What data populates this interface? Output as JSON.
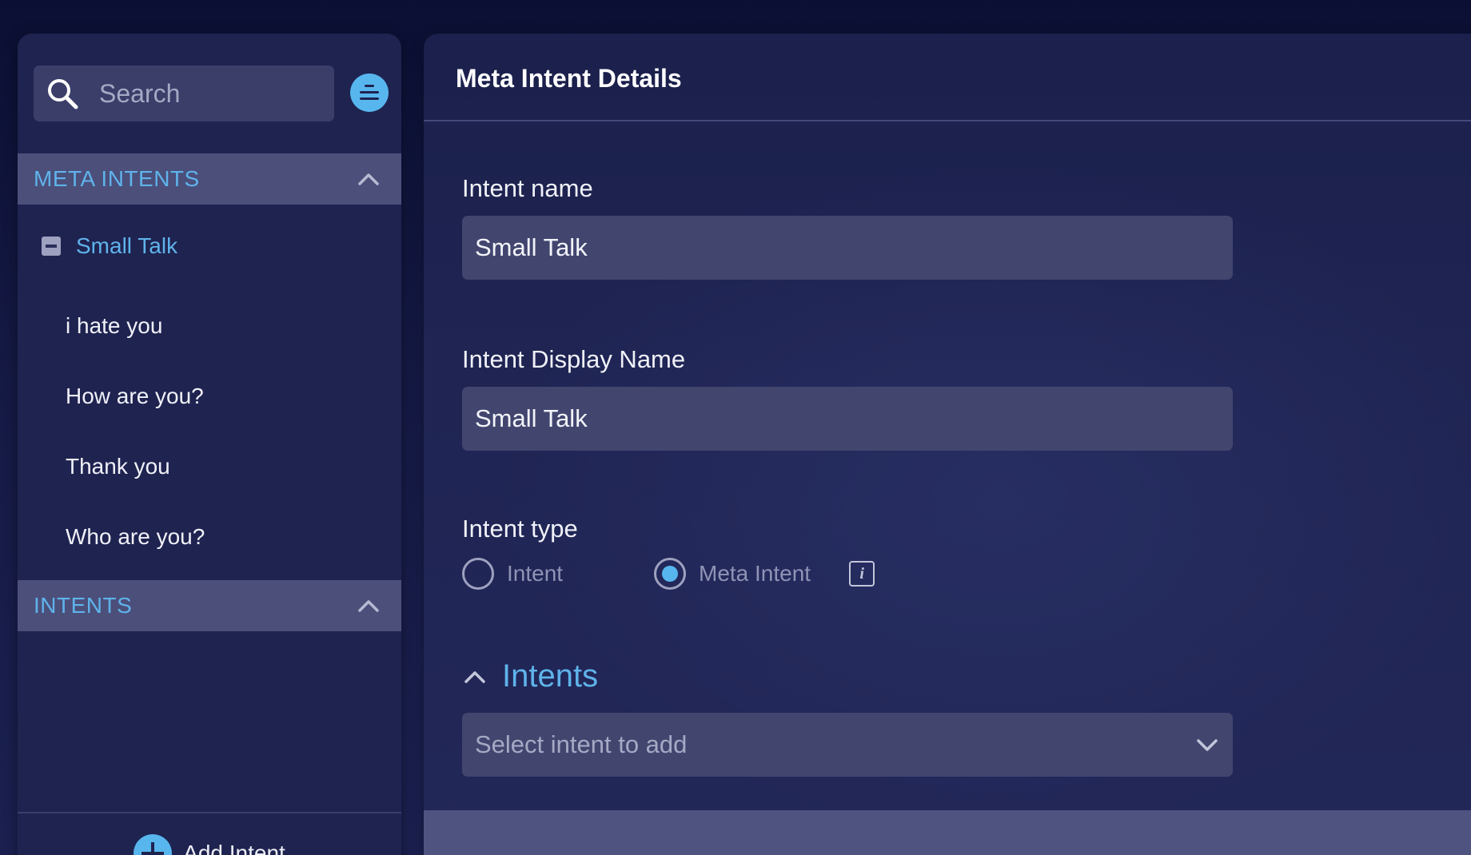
{
  "sidebar": {
    "search": {
      "placeholder": "Search",
      "icon": "search-icon"
    },
    "filter_icon": "filter-icon",
    "sections": [
      {
        "label": "META INTENTS",
        "expanded": true
      },
      {
        "label": "INTENTS",
        "expanded": true
      }
    ],
    "meta_intent": {
      "label": "Small Talk",
      "children": [
        "i hate you",
        "How are you?",
        "Thank you",
        "Who are you?"
      ]
    },
    "add_intent_label": "Add Intent"
  },
  "main": {
    "title": "Meta Intent Details",
    "intent_name": {
      "label": "Intent name",
      "value": "Small Talk"
    },
    "display_name": {
      "label": "Intent Display Name",
      "value": "Small Talk"
    },
    "intent_type": {
      "label": "Intent type",
      "options": [
        "Intent",
        "Meta Intent"
      ],
      "selected": "Meta Intent",
      "info_icon": "i"
    },
    "intents_section": {
      "label": "Intents",
      "select_placeholder": "Select intent to add"
    }
  },
  "colors": {
    "accent": "#58b6ee",
    "sidebar_bg": "#1f2350",
    "field_bg": "#42466f",
    "section_header_bg": "#4b4f7a"
  }
}
